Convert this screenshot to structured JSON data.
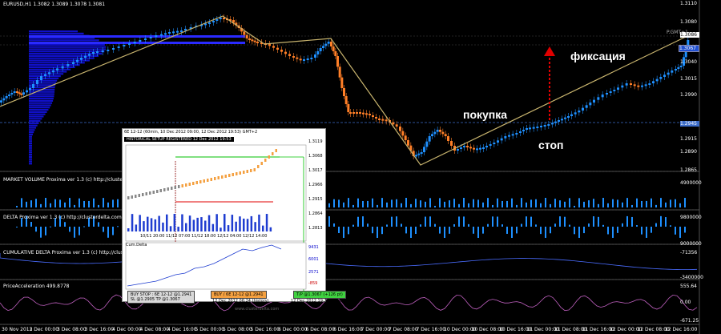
{
  "main_chart": {
    "symbol_line": "EURUSD,H1  1.3082 1.3089 1.3078 1.3081",
    "gmt_label": "P.GMT+1",
    "price_axis": [
      "1.3110",
      "1.3080",
      "1.3067",
      "1.3040",
      "1.3015",
      "1.2990",
      "1.2945",
      "1.2915",
      "1.2890",
      "1.2865"
    ],
    "tags": {
      "tag_blue": "1.3067",
      "tag_white": "1.3086",
      "tag_stop": "1.2945"
    },
    "annotations": {
      "fix": "фиксация",
      "buy": "покупка",
      "stop": "стоп"
    }
  },
  "panes": {
    "market_volume": {
      "label": "MARKET VOLUME Proxima ver 1.3 (c) http://clusterdelta.com",
      "axis_top": "4900000"
    },
    "delta": {
      "label": "DELTA Proxima ver 1.3 (c) http://clusterdelta.com",
      "axis_top": "9800000",
      "axis_bottom": "9000000"
    },
    "cumulative_delta": {
      "label": "CUMULATIVE DELTA Proxima ver 1.3 (c) http://clusterdelta.com",
      "axis_top": "-71356",
      "axis_bottom": "-3400000"
    },
    "price_accel": {
      "label": "PriceAcceleration 499.8778",
      "axis_top": "555.64",
      "axis_mid": "0.00",
      "axis_bottom": "-671.25"
    }
  },
  "time_axis": [
    "30 Nov 2012",
    "3 Dec 00:00",
    "3 Dec 08:00",
    "3 Dec 16:00",
    "4 Dec 00:00",
    "4 Dec 08:00",
    "4 Dec 16:00",
    "5 Dec 00:00",
    "5 Dec 08:00",
    "5 Dec 16:00",
    "6 Dec 00:00",
    "6 Dec 08:00",
    "6 Dec 16:00",
    "7 Dec 00:00",
    "7 Dec 08:00",
    "7 Dec 16:00",
    "10 Dec 00:00",
    "10 Dec 08:00",
    "10 Dec 16:00",
    "11 Dec 00:00",
    "11 Dec 08:00",
    "11 Dec 16:00",
    "12 Dec 00:00",
    "12 Dec 08:00",
    "12 Dec 16:00"
  ],
  "inset": {
    "header": "6E 12-12 (60min, 10 Dec 2012 09:00, 12 Dec 2012 19:53) GMT+2",
    "badge": "HISTORICAL SETUP REGISTERED 12 Dec 2012 19:53",
    "price_axis": [
      "1.3119",
      "1.3068",
      "1.3017",
      "1.2966",
      "1.2915",
      "1.2864",
      "1.2813"
    ],
    "time_axis": "10/11 20:00 11/12 07:00 11/12 18:00 12/12 04:00 12/12 14:00",
    "cum_header": "Cum.Delta",
    "cum_axis": [
      "9431",
      "6001",
      "2571",
      "-859"
    ],
    "buy_stop": {
      "line1": "BUY STOP : 6E 12-12 @1.2941",
      "line2": "SL @1.2905    TP @1.3067",
      "caption": "11 Dec 2012 05:49 (history)"
    },
    "buy": {
      "line1": "BUY / 6E 12-12 @1.2941",
      "line2": "12 Dec 2012 06:24 (history)"
    },
    "tp": {
      "line1": "T/P @1.3067 (+126 pt)",
      "line2": "12 Dec 2012 19:29 (history)"
    },
    "footer": "www.clusterdelta.com"
  },
  "colors": {
    "bull": "#1e90ff",
    "bear": "#ff7f27",
    "trend": "#c8b46e",
    "profile": "#1010c8",
    "stop_arrow": "#e00000",
    "tag_stop_bg": "#3c6cc8"
  }
}
